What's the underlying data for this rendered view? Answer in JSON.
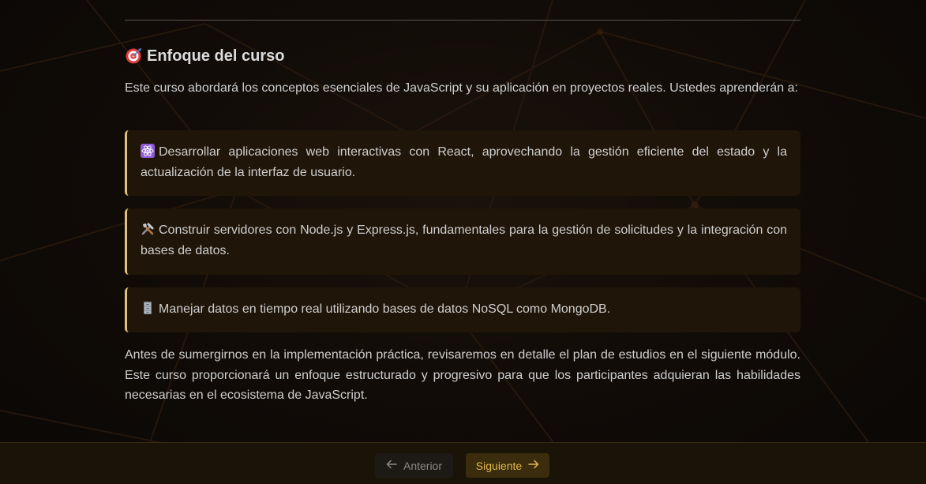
{
  "section": {
    "heading_icon": "target-icon",
    "heading": "Enfoque del curso",
    "intro": "Este curso abordará los conceptos esenciales de JavaScript y su aplicación en proyectos reales.  Ustedes aprenderán a:",
    "items": [
      {
        "icon": "atom-icon",
        "text": "Desarrollar aplicaciones web interactivas con React, aprovechando la gestión eficiente del estado y la actualización de la interfaz de usuario."
      },
      {
        "icon": "tools-icon",
        "text": "Construir servidores con Node.js y Express.js, fundamentales para la gestión de solicitudes y la integración con bases de datos."
      },
      {
        "icon": "file-cabinet-icon",
        "text": "Manejar datos en tiempo real utilizando bases de datos NoSQL como MongoDB."
      }
    ],
    "outro": "Antes de sumergirnos en la implementación práctica, revisaremos en detalle el plan de estudios en el siguiente módulo. Este curso proporcionará un enfoque estructurado y progresivo para que los participantes adquieran las habilidades necesarias en el ecosistema de JavaScript."
  },
  "nav": {
    "prev_label": "Anterior",
    "next_label": "Siguiente"
  },
  "colors": {
    "accent": "#e2c27a",
    "next_button_text": "#e0b84c",
    "card_bg": "#1f1508"
  }
}
